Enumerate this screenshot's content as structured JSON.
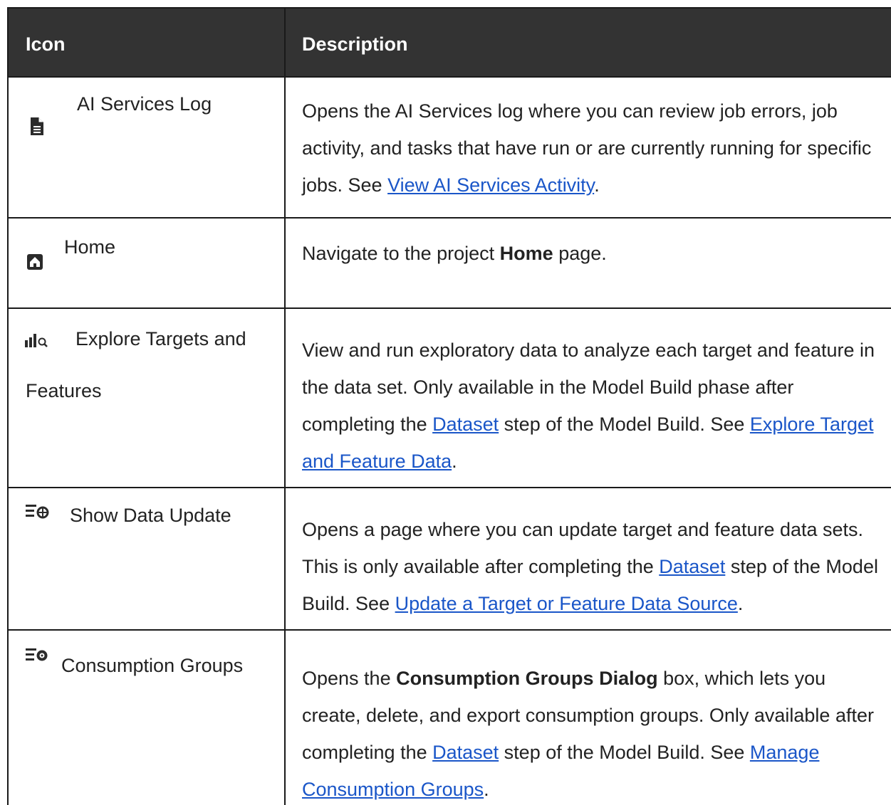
{
  "table": {
    "headers": {
      "icon": "Icon",
      "description": "Description"
    },
    "rows": [
      {
        "icon_name": "document-icon",
        "name": "AI Services Log",
        "desc": {
          "p1": "Opens the AI Services log where you can review job errors, job activity, and tasks that have run or are currently running for specific jobs. See ",
          "link1": " View AI Services Activity",
          "p2": "."
        }
      },
      {
        "icon_name": "home-icon",
        "name": "Home",
        "desc": {
          "p1": "Navigate to the project ",
          "bold1": "Home",
          "p2": " page."
        }
      },
      {
        "icon_name": "chart-search-icon",
        "name_line1": "Explore Targets and",
        "name_line2": "Features",
        "desc": {
          "p1": "View and run exploratory data to analyze each target and feature in the data set. Only available in the Model Build phase after completing the ",
          "link1": "Dataset",
          "p2": " step of the Model Build. See ",
          "link2": "Explore Target and Feature Data",
          "p3": "."
        }
      },
      {
        "icon_name": "data-update-icon",
        "name": "Show Data Update",
        "desc": {
          "p1": "Opens a page where you can update target and feature data sets. This is only available after completing the ",
          "link1": "Dataset",
          "p2": " step of the Model Build. See ",
          "link2": "Update a Target or Feature Data Source",
          "p3": "."
        }
      },
      {
        "icon_name": "consumption-groups-icon",
        "name": "Consumption Groups",
        "desc": {
          "p1": "Opens the ",
          "bold1": "Consumption Groups Dialog",
          "p2": " box, which lets you create, delete, and export consumption groups. Only available after completing the ",
          "link1": "Dataset",
          "p3": " step of the Model Build. See ",
          "link2": "Manage Consumption Groups",
          "p4": "."
        }
      }
    ]
  }
}
